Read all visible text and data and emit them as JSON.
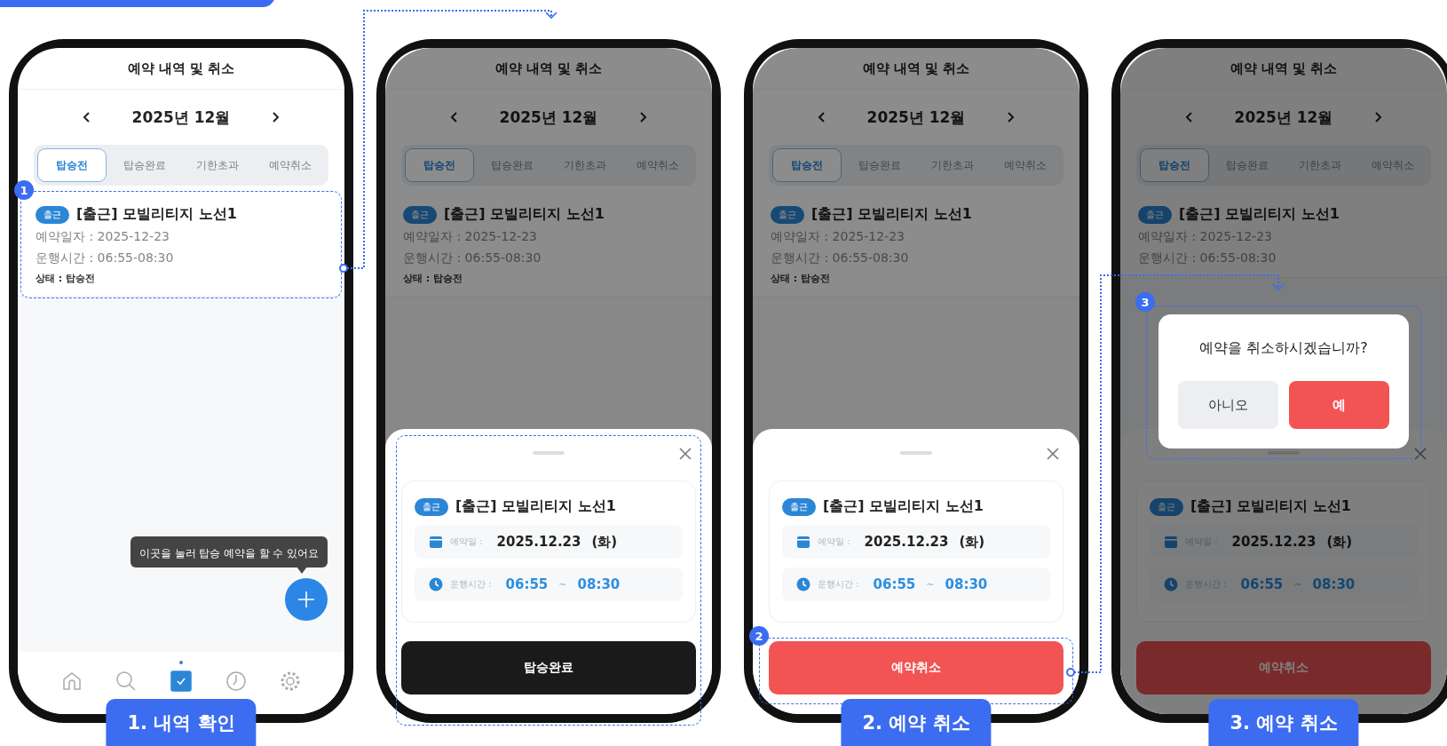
{
  "phones": [
    {
      "title": "예약 내역 및 취소",
      "month": "2025년 12월",
      "tabs": [
        {
          "label": "탑승전",
          "selected": true
        },
        {
          "label": "탑승완료",
          "selected": false
        },
        {
          "label": "기한초과",
          "selected": false
        },
        {
          "label": "예약취소",
          "selected": false
        }
      ],
      "reservation": {
        "badge": "출근",
        "name": "[출근] 모빌리티지 노선1",
        "date_line": "예약일자 : 2025-12-23",
        "time_line": "운행시간 : 06:55-08:30",
        "status_line": "상태 : 탑승전",
        "highlight": true,
        "marker": "1"
      },
      "tooltip": "이곳을 눌러 탑승 예약을 할 수 있어요",
      "nav": [
        {
          "kind": "home",
          "selected": false
        },
        {
          "kind": "search",
          "selected": false
        },
        {
          "kind": "check",
          "selected": true
        },
        {
          "kind": "clock",
          "selected": false
        },
        {
          "kind": "settings",
          "selected": false
        }
      ],
      "caption": "1. 내역 확인"
    },
    {
      "title": "예약 내역 및 취소",
      "month": "2025년 12월",
      "tabs": [
        {
          "label": "탑승전",
          "selected": true
        },
        {
          "label": "탑승완료",
          "selected": false
        },
        {
          "label": "기한초과",
          "selected": false
        },
        {
          "label": "예약취소",
          "selected": false
        }
      ],
      "reservation": {
        "badge": "출근",
        "name": "[출근] 모빌리티지 노선1",
        "date_line": "예약일자 : 2025-12-23",
        "time_line": "운행시간 : 06:55-08:30",
        "status_line": "상태 : 탑승전"
      },
      "dimmed": true,
      "sheet": {
        "highlight": true,
        "badge": "출근",
        "name": "[출근] 모빌리티지 노선1",
        "date_label": "예약일 :",
        "date_value": "2025.12.23",
        "weekday": "(화)",
        "time_label": "운행시간 :",
        "start": "06:55",
        "separator": "~",
        "end": "08:30",
        "button": {
          "label": "탑승완료",
          "kind": "dark"
        }
      }
    },
    {
      "title": "예약 내역 및 취소",
      "month": "2025년 12월",
      "tabs": [
        {
          "label": "탑승전",
          "selected": true
        },
        {
          "label": "탑승완료",
          "selected": false
        },
        {
          "label": "기한초과",
          "selected": false
        },
        {
          "label": "예약취소",
          "selected": false
        }
      ],
      "reservation": {
        "badge": "출근",
        "name": "[출근] 모빌리티지 노선1",
        "date_line": "예약일자 : 2025-12-23",
        "time_line": "운행시간 : 06:55-08:30",
        "status_line": "상태 : 탑승전"
      },
      "dimmed": true,
      "sheet": {
        "badge": "출근",
        "name": "[출근] 모빌리티지 노선1",
        "date_label": "예약일 :",
        "date_value": "2025.12.23",
        "weekday": "(화)",
        "time_label": "운행시간 :",
        "start": "06:55",
        "separator": "~",
        "end": "08:30",
        "button": {
          "label": "예약취소",
          "kind": "danger",
          "highlight": true,
          "marker": "2"
        }
      },
      "caption": "2. 예약 취소"
    },
    {
      "title": "예약 내역 및 취소",
      "month": "2025년 12월",
      "tabs": [
        {
          "label": "탑승전",
          "selected": true
        },
        {
          "label": "탑승완료",
          "selected": false
        },
        {
          "label": "기한초과",
          "selected": false
        },
        {
          "label": "예약취소",
          "selected": false
        }
      ],
      "reservation": {
        "badge": "출근",
        "name": "[출근] 모빌리티지 노선1",
        "date_line": "예약일자 : 2025-12-23",
        "time_line": "운행시간 : 06:55-08:30"
      },
      "dimmed": true,
      "sheet": {
        "badge": "출근",
        "name": "[출근] 모빌리티지 노선1",
        "date_label": "예약일 :",
        "date_value": "2025.12.23",
        "weekday": "(화)",
        "time_label": "운행시간 :",
        "start": "06:55",
        "separator": "~",
        "end": "08:30",
        "button": {
          "label": "예약취소",
          "kind": "danger"
        }
      },
      "dialog": {
        "message": "예약을 취소하시겠습니까?",
        "highlight": true,
        "marker": "3",
        "buttons": [
          {
            "label": "아니오",
            "kind": "secondary"
          },
          {
            "label": "예",
            "kind": "danger"
          }
        ]
      },
      "caption": "3. 예약 취소"
    }
  ]
}
